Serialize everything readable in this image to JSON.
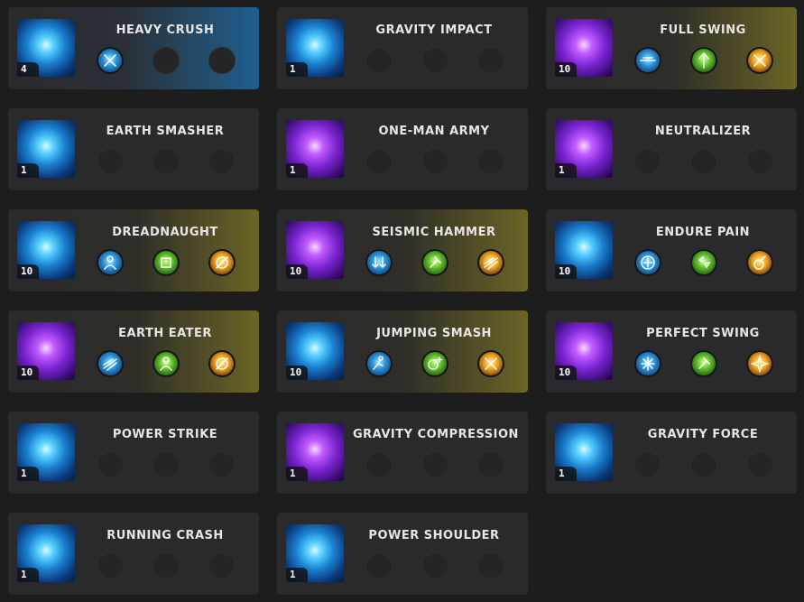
{
  "skills": [
    {
      "name": "HEAVY CRUSH",
      "level": "4",
      "icon": "heavy-crush-icon",
      "theme": "blue",
      "highlight": "blue",
      "nodes": [
        {
          "color": "blue",
          "glyph": "crossed-arrows-icon"
        },
        null,
        null
      ]
    },
    {
      "name": "GRAVITY IMPACT",
      "level": "1",
      "icon": "gravity-impact-icon",
      "theme": "blue",
      "highlight": "none",
      "nodes": [
        null,
        null,
        null
      ]
    },
    {
      "name": "FULL SWING",
      "level": "10",
      "icon": "full-swing-icon",
      "theme": "purple",
      "highlight": "gold",
      "nodes": [
        {
          "color": "blue",
          "glyph": "dash-icon"
        },
        {
          "color": "green",
          "glyph": "burst-up-icon"
        },
        {
          "color": "gold",
          "glyph": "crossed-arrows-icon"
        }
      ]
    },
    {
      "name": "EARTH SMASHER",
      "level": "1",
      "icon": "earth-smasher-icon",
      "theme": "blue",
      "highlight": "none",
      "nodes": [
        null,
        null,
        null
      ]
    },
    {
      "name": "ONE-MAN ARMY",
      "level": "1",
      "icon": "one-man-army-icon",
      "theme": "purple",
      "highlight": "none",
      "nodes": [
        null,
        null,
        null
      ]
    },
    {
      "name": "NEUTRALIZER",
      "level": "1",
      "icon": "neutralizer-icon",
      "theme": "purple",
      "highlight": "none",
      "nodes": [
        null,
        null,
        null
      ]
    },
    {
      "name": "DREADNAUGHT",
      "level": "10",
      "icon": "dreadnaught-icon",
      "theme": "blue",
      "highlight": "gold",
      "nodes": [
        {
          "color": "blue",
          "glyph": "person-icon"
        },
        {
          "color": "green",
          "glyph": "cube-icon"
        },
        {
          "color": "gold",
          "glyph": "orb-slash-icon"
        }
      ]
    },
    {
      "name": "SEISMIC HAMMER",
      "level": "10",
      "icon": "seismic-hammer-icon",
      "theme": "purple",
      "highlight": "gold",
      "nodes": [
        {
          "color": "blue",
          "glyph": "down-arrows-icon"
        },
        {
          "color": "green",
          "glyph": "hammer-icon"
        },
        {
          "color": "gold",
          "glyph": "streaks-icon"
        }
      ]
    },
    {
      "name": "ENDURE PAIN",
      "level": "10",
      "icon": "endure-pain-icon",
      "theme": "blue",
      "highlight": "none",
      "nodes": [
        {
          "color": "blue",
          "glyph": "compass-icon"
        },
        {
          "color": "green",
          "glyph": "shards-icon"
        },
        {
          "color": "gold",
          "glyph": "potion-icon"
        }
      ]
    },
    {
      "name": "EARTH EATER",
      "level": "10",
      "icon": "earth-eater-icon",
      "theme": "purple",
      "highlight": "gold",
      "nodes": [
        {
          "color": "blue",
          "glyph": "streaks-icon"
        },
        {
          "color": "green",
          "glyph": "person-icon"
        },
        {
          "color": "gold",
          "glyph": "orb-slash-icon"
        }
      ]
    },
    {
      "name": "JUMPING SMASH",
      "level": "10",
      "icon": "jumping-smash-icon",
      "theme": "blue",
      "highlight": "gold",
      "nodes": [
        {
          "color": "blue",
          "glyph": "runner-icon"
        },
        {
          "color": "green",
          "glyph": "orb-plus-icon"
        },
        {
          "color": "gold",
          "glyph": "crossed-arrows-icon"
        }
      ]
    },
    {
      "name": "PERFECT SWING",
      "level": "10",
      "icon": "perfect-swing-icon",
      "theme": "purple",
      "highlight": "none",
      "nodes": [
        {
          "color": "blue",
          "glyph": "burst-icon"
        },
        {
          "color": "green",
          "glyph": "hammer-icon"
        },
        {
          "color": "gold",
          "glyph": "sparkle-icon"
        }
      ]
    },
    {
      "name": "POWER STRIKE",
      "level": "1",
      "icon": "power-strike-icon",
      "theme": "blue",
      "highlight": "none",
      "nodes": [
        null,
        null,
        null
      ]
    },
    {
      "name": "GRAVITY COMPRESSION",
      "level": "1",
      "icon": "gravity-compression-icon",
      "theme": "purple",
      "highlight": "none",
      "nodes": [
        null,
        null,
        null
      ]
    },
    {
      "name": "GRAVITY FORCE",
      "level": "1",
      "icon": "gravity-force-icon",
      "theme": "blue",
      "highlight": "none",
      "nodes": [
        null,
        null,
        null
      ]
    },
    {
      "name": "RUNNING CRASH",
      "level": "1",
      "icon": "running-crash-icon",
      "theme": "blue",
      "highlight": "none",
      "nodes": [
        null,
        null,
        null
      ]
    },
    {
      "name": "POWER SHOULDER",
      "level": "1",
      "icon": "power-shoulder-icon",
      "theme": "blue",
      "highlight": "none",
      "nodes": [
        null,
        null,
        null
      ]
    }
  ]
}
